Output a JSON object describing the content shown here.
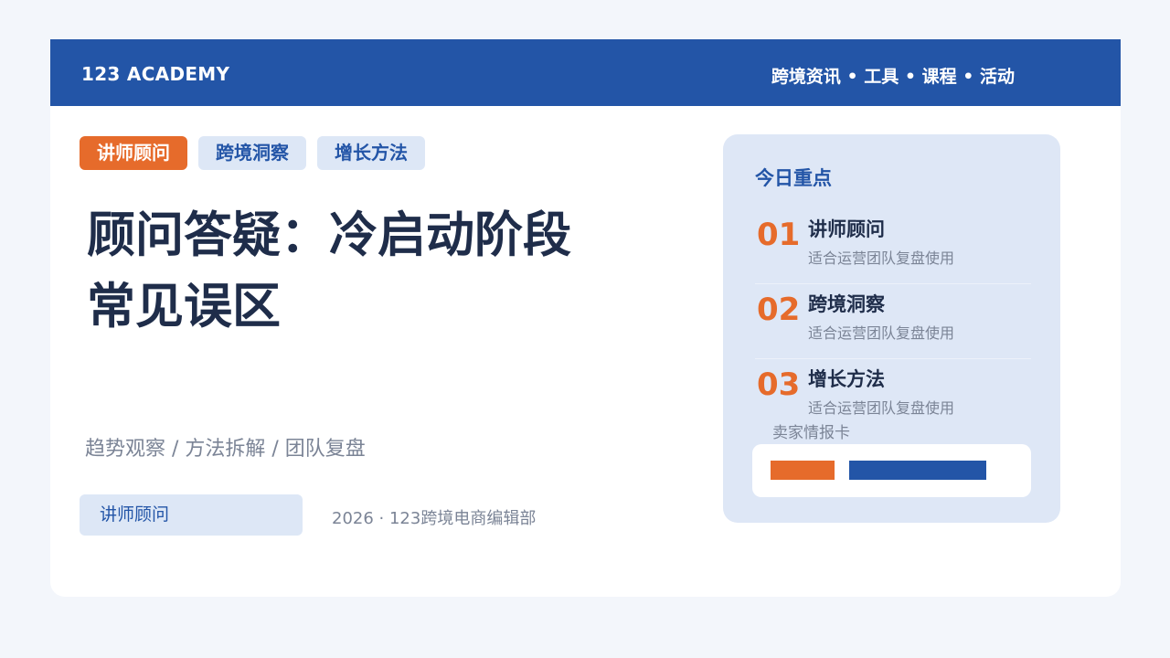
{
  "header": {
    "brand": "123 ACADEMY",
    "nav": "跨境资讯 • 工具 • 课程 • 活动"
  },
  "tags": [
    {
      "label": "讲师顾问",
      "color": "#e66b2b"
    },
    {
      "label": "跨境洞察",
      "color": "#dde7f6"
    },
    {
      "label": "增长方法",
      "color": "#dde7f6"
    }
  ],
  "main": {
    "title_line1": "顾问答疑：冷启动阶段",
    "title_line2": "常见误区",
    "subtitle": "趋势观察 / 方法拆解 / 团队复盘",
    "pill": "讲师顾问",
    "meta": "2026 · 123跨境电商编辑部"
  },
  "panel": {
    "title": "今日重点",
    "items": [
      {
        "num": "01",
        "title": "讲师顾问",
        "desc": "适合运营团队复盘使用"
      },
      {
        "num": "02",
        "title": "跨境洞察",
        "desc": "适合运营团队复盘使用"
      },
      {
        "num": "03",
        "title": "增长方法",
        "desc": "适合运营团队复盘使用"
      }
    ],
    "card_label": "卖家情报卡"
  },
  "colors": {
    "brand_blue": "#2355a7",
    "accent_orange": "#e66b2b",
    "light_blue": "#dde7f6",
    "text_dark": "#1f2d4a",
    "text_muted": "#7b8496"
  }
}
